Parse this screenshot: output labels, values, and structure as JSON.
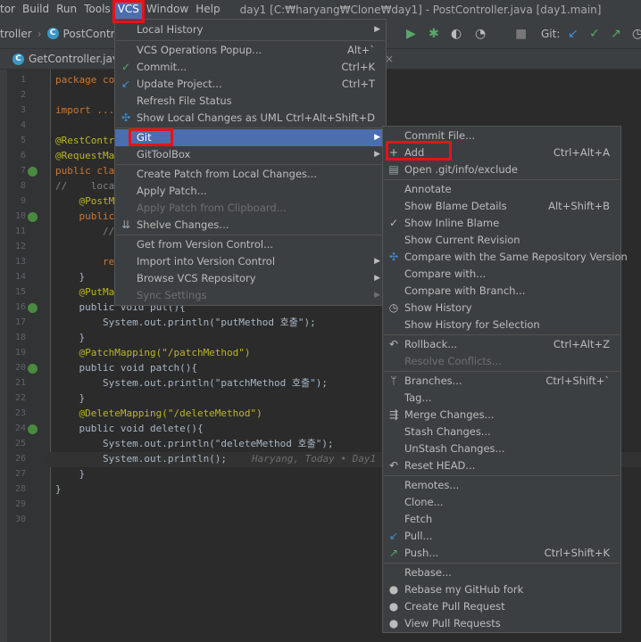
{
  "menubar": {
    "items": [
      "tor",
      "Build",
      "Run",
      "Tools",
      "VCS",
      "Window",
      "Help"
    ],
    "title": "day1 [C:₩haryang₩Clone₩day1] - PostController.java [day1.main]"
  },
  "navbar": {
    "breadcrumbs": [
      "troller",
      "PostControlle"
    ],
    "git_label": "Git:"
  },
  "tabs": {
    "left_tab": "GetController.java",
    "close": "×"
  },
  "editor": {
    "line_numbers": [
      "1",
      "2",
      "3",
      "4",
      "5",
      "6",
      "7",
      "8",
      "9",
      "10",
      "11",
      "12",
      "13",
      "14",
      "15",
      "16",
      "17",
      "18",
      "19",
      "20",
      "21",
      "22",
      "23",
      "24",
      "25",
      "26",
      "27",
      "28",
      "29",
      "30"
    ],
    "lines": [
      {
        "text": "package co"
      },
      {
        "text": ""
      },
      {
        "text": "import ..."
      },
      {
        "text": ""
      },
      {
        "text": "@RestContr"
      },
      {
        "text": "@RequestMa"
      },
      {
        "text": "public cla"
      },
      {
        "text": "//    loca"
      },
      {
        "text": "    @PostM"
      },
      {
        "text": "    public"
      },
      {
        "text": "        //"
      },
      {
        "text": ""
      },
      {
        "text": "        re"
      },
      {
        "text": "    }"
      },
      {
        "text": "    @PutMa"
      },
      {
        "text": "    public void put(){"
      },
      {
        "text": "        System.out.println(\"putMethod 호출\");"
      },
      {
        "text": "    }"
      },
      {
        "text": "    @PatchMapping(\"/patchMethod\")"
      },
      {
        "text": "    public void patch(){"
      },
      {
        "text": "        System.out.println(\"patchMethod 호출\");"
      },
      {
        "text": "    }"
      },
      {
        "text": "    @DeleteMapping(\"/deleteMethod\")"
      },
      {
        "text": "    public void delete(){"
      },
      {
        "text": "        System.out.println(\"deleteMethod 호출\");"
      },
      {
        "text": "        System.out.println();"
      },
      {
        "text": "    }"
      },
      {
        "text": "}"
      },
      {
        "text": ""
      },
      {
        "text": ""
      }
    ],
    "inline_hint": "Haryang, Today • Day1"
  },
  "vcs_menu": {
    "items": [
      {
        "label": "Local History",
        "arrow": true
      },
      {
        "sep": true
      },
      {
        "label": "VCS Operations Popup...",
        "shortcut": "Alt+`"
      },
      {
        "label": "Commit...",
        "shortcut": "Ctrl+K",
        "icon": "check-icon"
      },
      {
        "label": "Update Project...",
        "shortcut": "Ctrl+T",
        "icon": "update-icon"
      },
      {
        "label": "Refresh File Status"
      },
      {
        "label": "Show Local Changes as UML",
        "shortcut": "Ctrl+Alt+Shift+D",
        "icon": "uml-icon"
      },
      {
        "sep": true
      },
      {
        "label": "Git",
        "arrow": true,
        "selected": true
      },
      {
        "label": "GitToolBox",
        "arrow": true
      },
      {
        "sep": true
      },
      {
        "label": "Create Patch from Local Changes..."
      },
      {
        "label": "Apply Patch..."
      },
      {
        "label": "Apply Patch from Clipboard...",
        "disabled": true
      },
      {
        "label": "Shelve Changes...",
        "icon": "shelve-icon"
      },
      {
        "sep": true
      },
      {
        "label": "Get from Version Control..."
      },
      {
        "label": "Import into Version Control",
        "arrow": true
      },
      {
        "label": "Browse VCS Repository",
        "arrow": true
      },
      {
        "label": "Sync Settings",
        "arrow": true,
        "disabled": true
      }
    ]
  },
  "git_menu": {
    "items": [
      {
        "label": "Commit File..."
      },
      {
        "label": "Add",
        "shortcut": "Ctrl+Alt+A",
        "icon": "plus-icon"
      },
      {
        "label": "Open .git/info/exclude",
        "icon": "file-icon"
      },
      {
        "sep": true
      },
      {
        "label": "Annotate"
      },
      {
        "label": "Show Blame Details",
        "shortcut": "Alt+Shift+B"
      },
      {
        "label": "Show Inline Blame",
        "icon": "check-icon"
      },
      {
        "label": "Show Current Revision"
      },
      {
        "label": "Compare with the Same Repository Version",
        "icon": "compare-icon"
      },
      {
        "label": "Compare with..."
      },
      {
        "label": "Compare with Branch..."
      },
      {
        "label": "Show History",
        "icon": "clock-icon"
      },
      {
        "label": "Show History for Selection"
      },
      {
        "sep": true
      },
      {
        "label": "Rollback...",
        "shortcut": "Ctrl+Alt+Z",
        "icon": "rollback-icon"
      },
      {
        "label": "Resolve Conflicts...",
        "disabled": true
      },
      {
        "sep": true
      },
      {
        "label": "Branches...",
        "shortcut": "Ctrl+Shift+`",
        "icon": "branch-icon"
      },
      {
        "label": "Tag..."
      },
      {
        "label": "Merge Changes...",
        "icon": "merge-icon"
      },
      {
        "label": "Stash Changes..."
      },
      {
        "label": "UnStash Changes..."
      },
      {
        "label": "Reset HEAD...",
        "icon": "reset-icon"
      },
      {
        "sep": true
      },
      {
        "label": "Remotes..."
      },
      {
        "label": "Clone..."
      },
      {
        "label": "Fetch"
      },
      {
        "label": "Pull...",
        "icon": "pull-icon"
      },
      {
        "label": "Push...",
        "shortcut": "Ctrl+Shift+K",
        "icon": "push-icon"
      },
      {
        "sep": true
      },
      {
        "label": "Rebase..."
      },
      {
        "label": "Rebase my GitHub fork",
        "icon": "github-icon"
      },
      {
        "label": "Create Pull Request",
        "icon": "github-icon"
      },
      {
        "label": "View Pull Requests",
        "icon": "github-icon"
      }
    ]
  },
  "colors": {
    "menu_bg": "#3c3f41",
    "selection": "#4b6eaf",
    "highlight_box": "#e8111a"
  }
}
